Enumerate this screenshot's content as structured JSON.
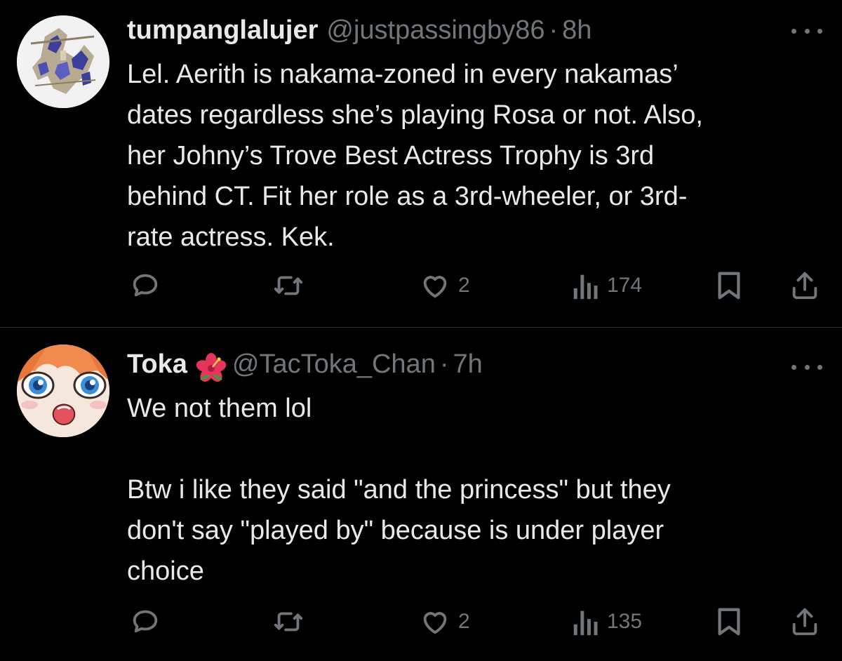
{
  "tweets": [
    {
      "display_name": "tumpanglalujer",
      "handle": "@justpassingby86",
      "separator": "·",
      "time": "8h",
      "text_lines": [
        "Lel. Aerith is nakama-zoned in every nakamas’",
        "dates regardless she’s playing Rosa or not. Also,",
        "her Johny’s Trove Best Actress Trophy is 3rd",
        "behind CT. Fit her role as a 3rd-wheeler, or 3rd-",
        "rate actress. Kek."
      ],
      "likes": "2",
      "views": "174"
    },
    {
      "display_name": "Toka",
      "name_emoji": "hibiscus-flower",
      "handle": "@TacToka_Chan",
      "separator": "·",
      "time": "7h",
      "text_lines": [
        "We not them lol",
        "",
        "Btw i like they said \"and the princess\" but they",
        "don't say \"played by\" because is under player",
        "choice"
      ],
      "likes": "2",
      "views": "135"
    }
  ],
  "colors": {
    "background": "#000000",
    "text": "#e7e9ea",
    "muted": "#71767b",
    "divider": "#2f3336"
  },
  "icons": [
    "reply-icon",
    "retweet-icon",
    "like-icon",
    "views-icon",
    "bookmark-icon",
    "share-icon",
    "more-icon"
  ]
}
